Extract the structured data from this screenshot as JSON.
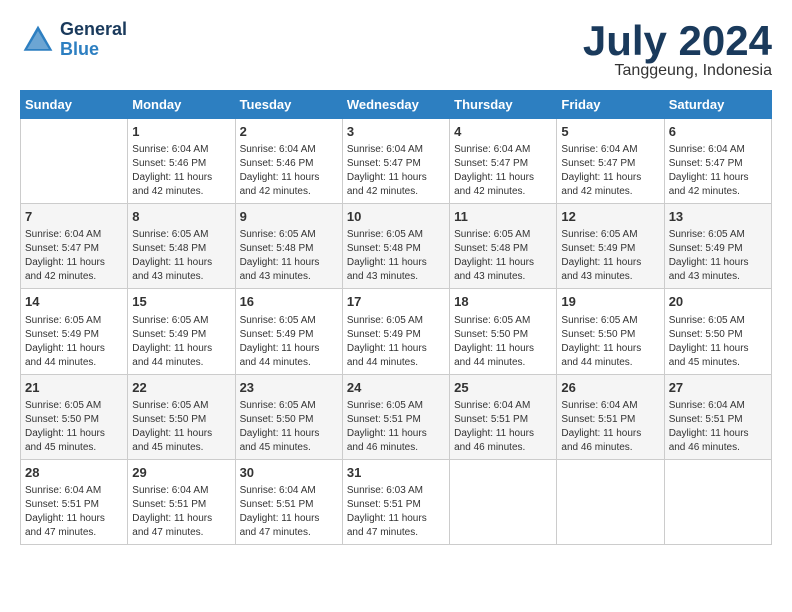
{
  "header": {
    "logo_line1": "General",
    "logo_line2": "Blue",
    "month": "July 2024",
    "location": "Tanggeung, Indonesia"
  },
  "days_of_week": [
    "Sunday",
    "Monday",
    "Tuesday",
    "Wednesday",
    "Thursday",
    "Friday",
    "Saturday"
  ],
  "weeks": [
    [
      {
        "day": "",
        "info": ""
      },
      {
        "day": "1",
        "info": "Sunrise: 6:04 AM\nSunset: 5:46 PM\nDaylight: 11 hours\nand 42 minutes."
      },
      {
        "day": "2",
        "info": "Sunrise: 6:04 AM\nSunset: 5:46 PM\nDaylight: 11 hours\nand 42 minutes."
      },
      {
        "day": "3",
        "info": "Sunrise: 6:04 AM\nSunset: 5:47 PM\nDaylight: 11 hours\nand 42 minutes."
      },
      {
        "day": "4",
        "info": "Sunrise: 6:04 AM\nSunset: 5:47 PM\nDaylight: 11 hours\nand 42 minutes."
      },
      {
        "day": "5",
        "info": "Sunrise: 6:04 AM\nSunset: 5:47 PM\nDaylight: 11 hours\nand 42 minutes."
      },
      {
        "day": "6",
        "info": "Sunrise: 6:04 AM\nSunset: 5:47 PM\nDaylight: 11 hours\nand 42 minutes."
      }
    ],
    [
      {
        "day": "7",
        "info": "Sunrise: 6:04 AM\nSunset: 5:47 PM\nDaylight: 11 hours\nand 42 minutes."
      },
      {
        "day": "8",
        "info": "Sunrise: 6:05 AM\nSunset: 5:48 PM\nDaylight: 11 hours\nand 43 minutes."
      },
      {
        "day": "9",
        "info": "Sunrise: 6:05 AM\nSunset: 5:48 PM\nDaylight: 11 hours\nand 43 minutes."
      },
      {
        "day": "10",
        "info": "Sunrise: 6:05 AM\nSunset: 5:48 PM\nDaylight: 11 hours\nand 43 minutes."
      },
      {
        "day": "11",
        "info": "Sunrise: 6:05 AM\nSunset: 5:48 PM\nDaylight: 11 hours\nand 43 minutes."
      },
      {
        "day": "12",
        "info": "Sunrise: 6:05 AM\nSunset: 5:49 PM\nDaylight: 11 hours\nand 43 minutes."
      },
      {
        "day": "13",
        "info": "Sunrise: 6:05 AM\nSunset: 5:49 PM\nDaylight: 11 hours\nand 43 minutes."
      }
    ],
    [
      {
        "day": "14",
        "info": "Sunrise: 6:05 AM\nSunset: 5:49 PM\nDaylight: 11 hours\nand 44 minutes."
      },
      {
        "day": "15",
        "info": "Sunrise: 6:05 AM\nSunset: 5:49 PM\nDaylight: 11 hours\nand 44 minutes."
      },
      {
        "day": "16",
        "info": "Sunrise: 6:05 AM\nSunset: 5:49 PM\nDaylight: 11 hours\nand 44 minutes."
      },
      {
        "day": "17",
        "info": "Sunrise: 6:05 AM\nSunset: 5:49 PM\nDaylight: 11 hours\nand 44 minutes."
      },
      {
        "day": "18",
        "info": "Sunrise: 6:05 AM\nSunset: 5:50 PM\nDaylight: 11 hours\nand 44 minutes."
      },
      {
        "day": "19",
        "info": "Sunrise: 6:05 AM\nSunset: 5:50 PM\nDaylight: 11 hours\nand 44 minutes."
      },
      {
        "day": "20",
        "info": "Sunrise: 6:05 AM\nSunset: 5:50 PM\nDaylight: 11 hours\nand 45 minutes."
      }
    ],
    [
      {
        "day": "21",
        "info": "Sunrise: 6:05 AM\nSunset: 5:50 PM\nDaylight: 11 hours\nand 45 minutes."
      },
      {
        "day": "22",
        "info": "Sunrise: 6:05 AM\nSunset: 5:50 PM\nDaylight: 11 hours\nand 45 minutes."
      },
      {
        "day": "23",
        "info": "Sunrise: 6:05 AM\nSunset: 5:50 PM\nDaylight: 11 hours\nand 45 minutes."
      },
      {
        "day": "24",
        "info": "Sunrise: 6:05 AM\nSunset: 5:51 PM\nDaylight: 11 hours\nand 46 minutes."
      },
      {
        "day": "25",
        "info": "Sunrise: 6:04 AM\nSunset: 5:51 PM\nDaylight: 11 hours\nand 46 minutes."
      },
      {
        "day": "26",
        "info": "Sunrise: 6:04 AM\nSunset: 5:51 PM\nDaylight: 11 hours\nand 46 minutes."
      },
      {
        "day": "27",
        "info": "Sunrise: 6:04 AM\nSunset: 5:51 PM\nDaylight: 11 hours\nand 46 minutes."
      }
    ],
    [
      {
        "day": "28",
        "info": "Sunrise: 6:04 AM\nSunset: 5:51 PM\nDaylight: 11 hours\nand 47 minutes."
      },
      {
        "day": "29",
        "info": "Sunrise: 6:04 AM\nSunset: 5:51 PM\nDaylight: 11 hours\nand 47 minutes."
      },
      {
        "day": "30",
        "info": "Sunrise: 6:04 AM\nSunset: 5:51 PM\nDaylight: 11 hours\nand 47 minutes."
      },
      {
        "day": "31",
        "info": "Sunrise: 6:03 AM\nSunset: 5:51 PM\nDaylight: 11 hours\nand 47 minutes."
      },
      {
        "day": "",
        "info": ""
      },
      {
        "day": "",
        "info": ""
      },
      {
        "day": "",
        "info": ""
      }
    ]
  ]
}
